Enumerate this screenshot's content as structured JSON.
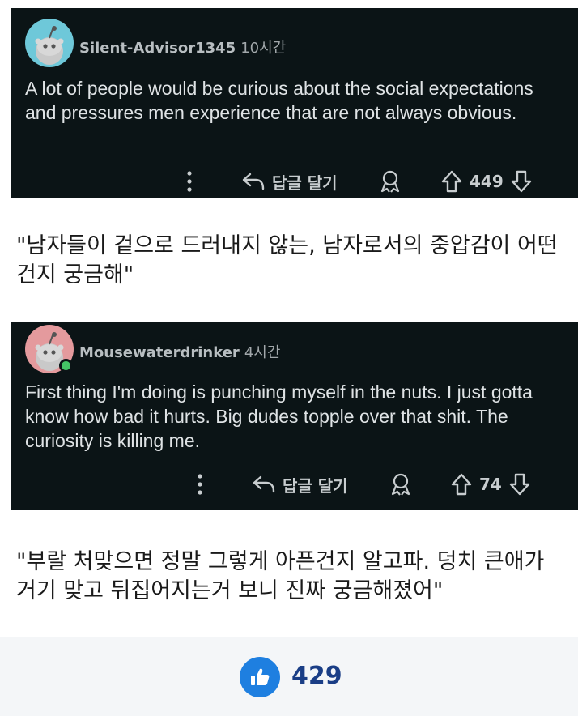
{
  "comments": [
    {
      "username": "Silent-Advisor1345",
      "time": "10시간",
      "text": "A lot of people would be curious about the social expectations and pressures men experience that are not always obvious.",
      "reply_label": "답글 달기",
      "votes": "449",
      "avatar_color": "#6ec8d9",
      "online": false
    },
    {
      "username": "Mousewaterdrinker",
      "time": "4시간",
      "text": "First thing I'm doing is punching myself in the nuts. I just gotta know how bad it hurts. Big dudes topple over that shit. The curiosity is killing me.",
      "reply_label": "답글 달기",
      "votes": "74",
      "avatar_color": "#e49a9d",
      "online": true
    }
  ],
  "translations": [
    "\"남자들이 겉으로 드러내지 않는, 남자로서의 중압감이 어떤건지 궁금해\"",
    "\"부랄 처맞으면 정말 그렇게 아픈건지 알고파. 덩치 큰애가 거기 맞고 뒤집어지는거 보니 진짜 궁금해졌어\""
  ],
  "footer": {
    "like_count": "429",
    "like_color": "#1e7fe0"
  },
  "icons": {
    "more": "more-options-icon",
    "reply": "reply-arrow-icon",
    "award": "award-icon",
    "upvote": "upvote-arrow-icon",
    "downvote": "downvote-arrow-icon",
    "like": "thumbs-up-icon"
  }
}
